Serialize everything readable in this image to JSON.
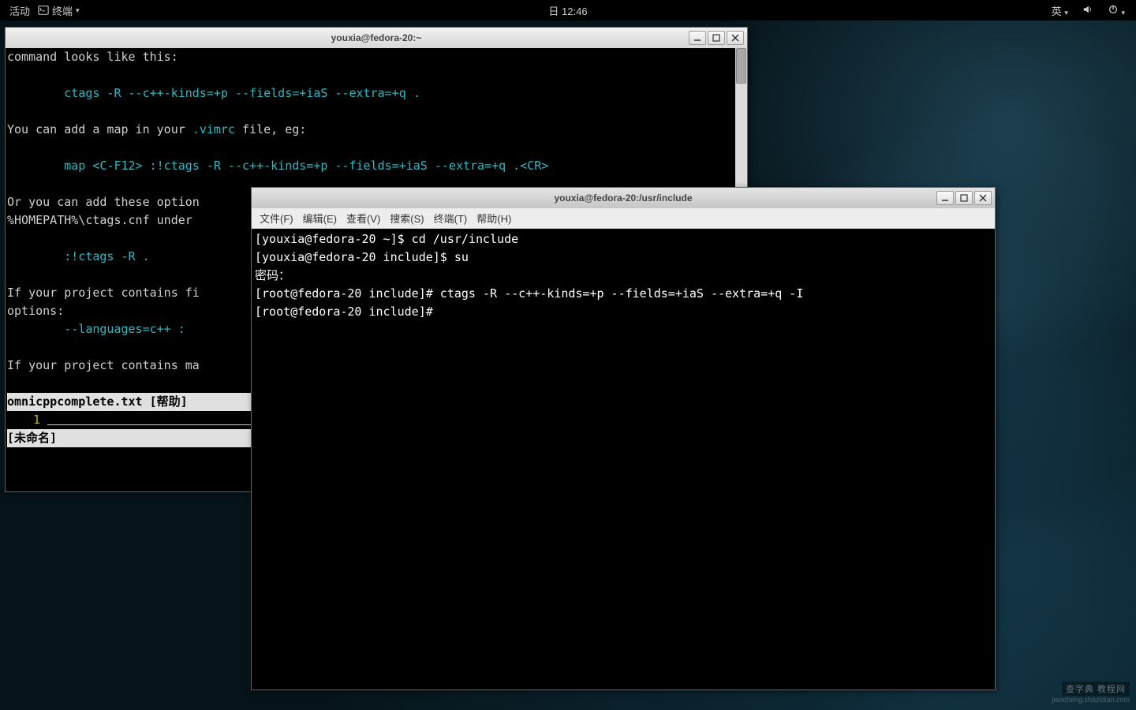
{
  "topbar": {
    "activities": "活动",
    "app_name": "终端",
    "clock": "日 12:46",
    "ime": "英"
  },
  "vim_window": {
    "title": "youxia@fedora-20:~",
    "lines": {
      "l1": "command looks like this:",
      "l2": "        ctags -R --c++-kinds=+p --fields=+iaS --extra=+q .",
      "l3a": "You can add a map in your ",
      "l3b": ".vimrc",
      "l3c": " file, eg:",
      "l4": "        map <C-F12> :!ctags -R --c++-kinds=+p --fields=+iaS --extra=+q .<CR>",
      "l5": "Or you can add these option",
      "l6a": "%HOMEPATH%\\ctags.cnf under ",
      "l7": "        :!ctags -R .",
      "l8": "If your project contains fi",
      "l9": "options:",
      "l10": "        --languages=c++ : ",
      "l11": "If your project contains ma"
    },
    "status1": "omnicppcomplete.txt [帮助]",
    "gutter_num": "1",
    "status2": "[未命名]"
  },
  "term_window": {
    "title": "youxia@fedora-20:/usr/include",
    "menu": {
      "file": "文件(F)",
      "edit": "编辑(E)",
      "view": "查看(V)",
      "search": "搜索(S)",
      "terminal": "终端(T)",
      "help": "帮助(H)"
    },
    "lines": {
      "p1": "[youxia@fedora-20 ~]$ cd /usr/include",
      "p2": "[youxia@fedora-20 include]$ su",
      "p3": "密码：",
      "p4": "[root@fedora-20 include]# ctags -R --c++-kinds=+p --fields=+iaS --extra=+q -I",
      "p5": "[root@fedora-20 include]# "
    }
  },
  "watermark": {
    "main": "查字典 教程网",
    "sub": "jiaocheng.chazidian.com"
  }
}
